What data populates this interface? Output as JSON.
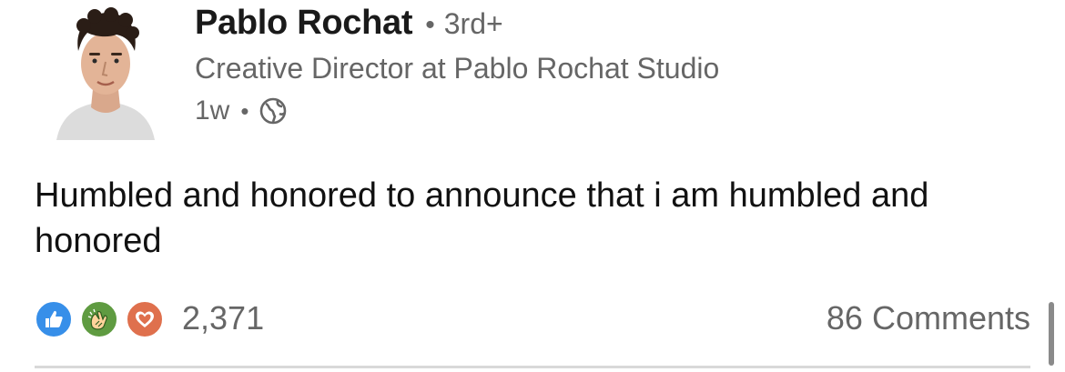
{
  "author": {
    "name": "Pablo Rochat",
    "degree": "3rd+",
    "headline": "Creative Director at Pablo Rochat Studio",
    "posted_ago": "1w",
    "visibility_icon": "globe-icon"
  },
  "post": {
    "text": "Humbled and honored to announce that i am humbled and honored"
  },
  "social": {
    "reaction_icons": [
      "like-icon",
      "celebrate-icon",
      "love-icon"
    ],
    "reaction_count": "2,371",
    "comments_label": "86 Comments"
  },
  "colors": {
    "like": "#378fe9",
    "celebrate": "#5f9b41",
    "love": "#df704d",
    "secondary_text": "#666666"
  }
}
